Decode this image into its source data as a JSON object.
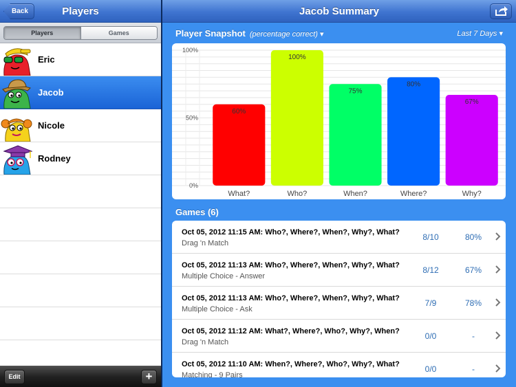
{
  "left": {
    "back_label": "Back",
    "title": "Players",
    "segments": [
      {
        "label": "Players",
        "selected": true
      },
      {
        "label": "Games",
        "selected": false
      }
    ],
    "players": [
      {
        "name": "Eric",
        "selected": false,
        "avatar_color": "#e8202a",
        "avatar_icon": "monster-cap-sunglasses-icon"
      },
      {
        "name": "Jacob",
        "selected": true,
        "avatar_color": "#3cb44a",
        "avatar_icon": "monster-hat-icon"
      },
      {
        "name": "Nicole",
        "selected": false,
        "avatar_color": "#f5d21c",
        "avatar_icon": "monster-pigtails-icon"
      },
      {
        "name": "Rodney",
        "selected": false,
        "avatar_color": "#26a3e8",
        "avatar_icon": "monster-graduate-icon"
      }
    ],
    "edit_label": "Edit",
    "add_label": "+"
  },
  "right": {
    "title": "Jacob Summary",
    "share_icon": "share-icon",
    "snapshot": {
      "title": "Player Snapshot",
      "subtitle": "(percentage correct) ▾",
      "range": "Last 7 Days ▾"
    },
    "games_header": "Games (6)",
    "games": [
      {
        "title": "Oct 05, 2012  11:15 AM: Who?, Where?, When?, Why?, What?",
        "mode": "Drag 'n Match",
        "score": "8/10",
        "percent": "80%"
      },
      {
        "title": "Oct 05, 2012  11:13 AM: Who?, Where?, When?, Why?, What?",
        "mode": "Multiple Choice - Answer",
        "score": "8/12",
        "percent": "67%"
      },
      {
        "title": "Oct 05, 2012  11:13 AM: Who?, Where?, When?, Why?, What?",
        "mode": "Multiple Choice - Ask",
        "score": "7/9",
        "percent": "78%"
      },
      {
        "title": "Oct 05, 2012  11:12 AM: What?, Where?, Who?, Why?, When?",
        "mode": "Drag 'n Match",
        "score": "0/0",
        "percent": "-"
      },
      {
        "title": "Oct 05, 2012  11:10 AM: When?, Where?, Who?, Why?, What?",
        "mode": "Matching - 9 Pairs",
        "score": "0/0",
        "percent": "-"
      }
    ]
  },
  "chart_data": {
    "type": "bar",
    "categories": [
      "What?",
      "Who?",
      "When?",
      "Where?",
      "Why?"
    ],
    "values": [
      60,
      100,
      75,
      80,
      67
    ],
    "value_labels": [
      "60%",
      "100%",
      "75%",
      "80%",
      "67%"
    ],
    "colors": [
      "#ff0000",
      "#ccff00",
      "#00ff66",
      "#0066ff",
      "#cc00ff"
    ],
    "yticks": [
      "0%",
      "50%",
      "100%"
    ],
    "ylim": [
      0,
      100
    ],
    "grid": true
  }
}
